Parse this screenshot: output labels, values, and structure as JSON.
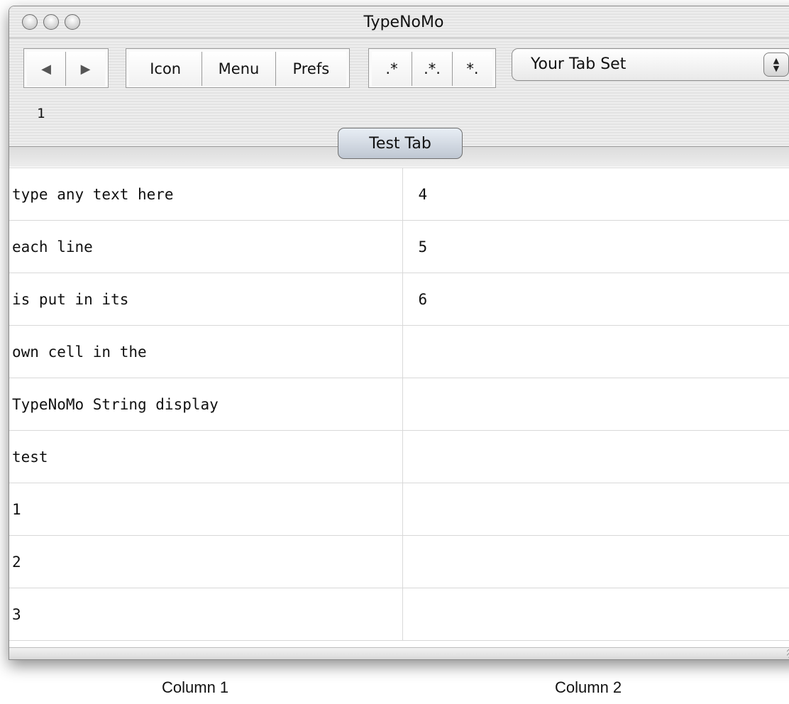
{
  "window": {
    "title": "TypeNoMo"
  },
  "toolbar": {
    "nav": {
      "back_icon": "◀",
      "forward_icon": "▶"
    },
    "view_buttons": {
      "icon": "Icon",
      "menu": "Menu",
      "prefs": "Prefs"
    },
    "pattern_buttons": {
      "p1": ".*",
      "p2": ".*.",
      "p3": "*."
    },
    "tab_set_popup": {
      "selected": "Your Tab Set"
    },
    "counter": "1"
  },
  "tab": {
    "label": "Test Tab"
  },
  "table": {
    "rows": [
      [
        "type any text here",
        "4"
      ],
      [
        "each line",
        "5"
      ],
      [
        "is put in its",
        "6"
      ],
      [
        "own cell in the",
        ""
      ],
      [
        "TypeNoMo String display",
        ""
      ],
      [
        "test",
        ""
      ],
      [
        "1",
        ""
      ],
      [
        "2",
        ""
      ],
      [
        "3",
        ""
      ]
    ]
  },
  "captions": {
    "col1": "Column 1",
    "col2": "Column 2"
  }
}
